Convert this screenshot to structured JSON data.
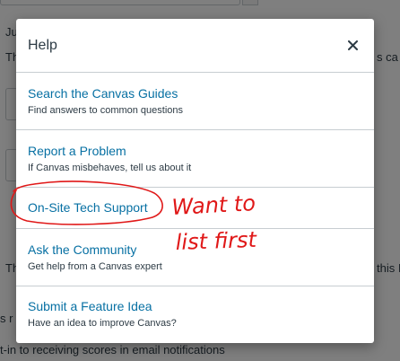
{
  "background": {
    "left_fragments": [
      "Ju",
      "Th",
      "Th",
      "s r",
      "t-in to receiving scores in email notifications"
    ],
    "right_fragments": [
      "s ca",
      "this I"
    ]
  },
  "modal": {
    "title": "Help",
    "close_label": "×",
    "items": [
      {
        "label": "Search the Canvas Guides",
        "description": "Find answers to common questions"
      },
      {
        "label": "Report a Problem",
        "description": "If Canvas misbehaves, tell us about it"
      },
      {
        "label": "On-Site Tech Support",
        "description": ""
      },
      {
        "label": "Ask the Community",
        "description": "Get help from a Canvas expert"
      },
      {
        "label": "Submit a Feature Idea",
        "description": "Have an idea to improve Canvas?"
      }
    ]
  },
  "annotation": {
    "line1": "Want to",
    "line2": "list first",
    "color": "#e01818"
  },
  "colors": {
    "link": "#0770a3",
    "text": "#2d3b45",
    "border": "#c7cdd1"
  }
}
